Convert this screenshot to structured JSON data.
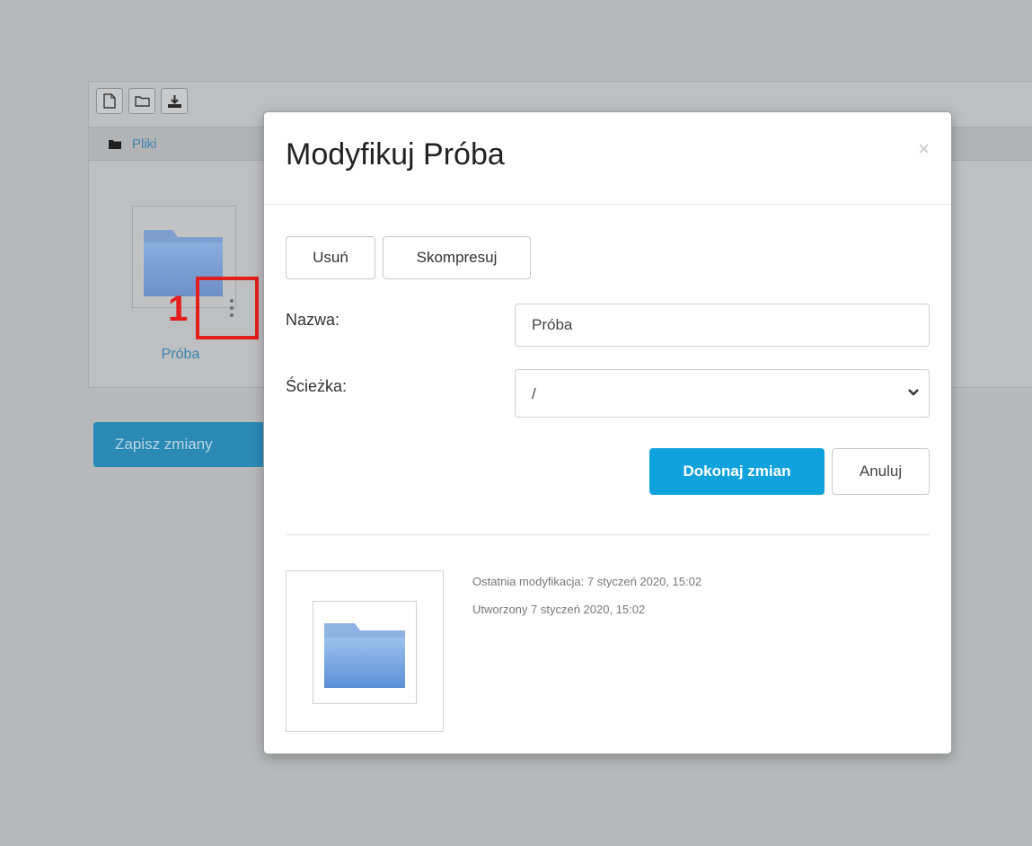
{
  "file_manager": {
    "breadcrumb": "Pliki",
    "item_name": "Próba",
    "save_button": "Zapisz zmiany",
    "annotation_number": "1",
    "toolbar_icons": [
      "new-file-icon",
      "new-folder-icon",
      "upload-icon"
    ]
  },
  "modal": {
    "title": "Modyfikuj Próba",
    "close_label": "×",
    "delete_button": "Usuń",
    "compress_button": "Skompresuj",
    "name_label": "Nazwa:",
    "name_value": "Próba",
    "path_label": "Ścieżka:",
    "path_value": "/",
    "submit_button": "Dokonaj zmian",
    "cancel_button": "Anuluj",
    "modified_text": "Ostatnia modyfikacja:  7 styczeń 2020, 15:02",
    "created_text": "Utworzony  7 styczeń 2020, 15:02"
  },
  "colors": {
    "accent": "#0fa2dc",
    "link": "#3b84b4",
    "annotation": "#e31e1e"
  }
}
